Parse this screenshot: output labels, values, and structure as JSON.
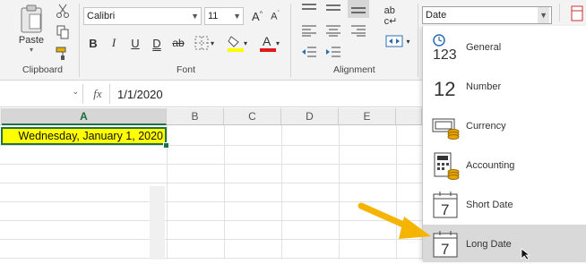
{
  "ribbon": {
    "clipboard": {
      "paste_label": "Paste",
      "group_label": "Clipboard"
    },
    "font": {
      "font_name": "Calibri",
      "font_size": "11",
      "group_label": "Font",
      "bold": "B",
      "italic": "I",
      "underline": "U",
      "double_underline": "D",
      "strike": "ab"
    },
    "alignment": {
      "group_label": "Alignment"
    },
    "number": {
      "format_value": "Date"
    }
  },
  "formula_bar": {
    "fx_label": "fx",
    "value": "1/1/2020"
  },
  "grid": {
    "columns": [
      "A",
      "B",
      "C",
      "D",
      "E"
    ],
    "active_cell_value": "Wednesday, January 1, 2020"
  },
  "format_menu": {
    "items": [
      {
        "label": "General",
        "icon": "general-123-icon"
      },
      {
        "label": "Number",
        "icon": "number-12-icon"
      },
      {
        "label": "Currency",
        "icon": "currency-icon"
      },
      {
        "label": "Accounting",
        "icon": "accounting-icon"
      },
      {
        "label": "Short Date",
        "icon": "calendar-icon"
      },
      {
        "label": "Long Date",
        "icon": "calendar-icon",
        "highlighted": true
      }
    ],
    "general_icon_text": "123",
    "number_icon_text": "12",
    "calendar_icon_text": "7"
  },
  "colors": {
    "highlight_yellow": "#ffff00",
    "font_red": "#e0191c",
    "accent_green": "#217346",
    "arrow_orange": "#f5b400"
  }
}
